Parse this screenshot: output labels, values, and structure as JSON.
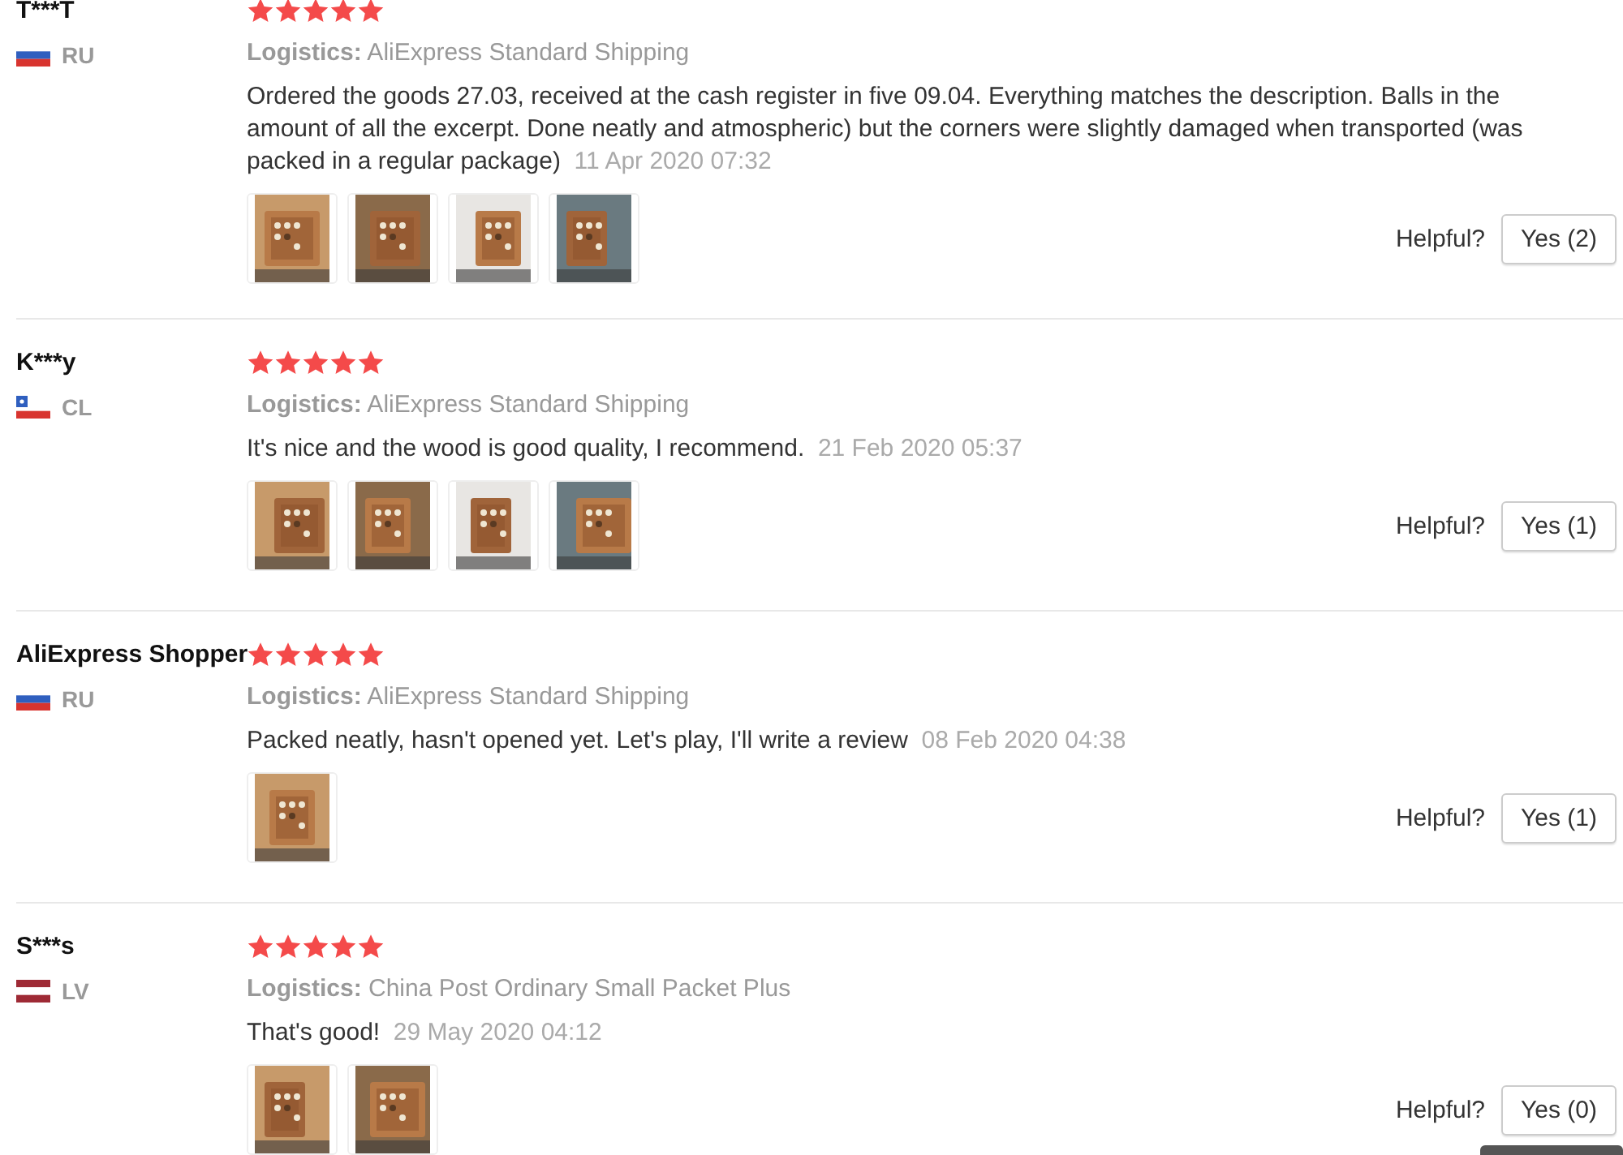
{
  "reviews": [
    {
      "name": "T***T",
      "country": "RU",
      "stars": 5,
      "logistics_label": "Logistics:",
      "logistics": "AliExpress Standard Shipping",
      "text": "Ordered the goods 27.03, received at the cash register in five 09.04. Everything matches the description. Balls in the amount of all the excerpt. Done neatly and atmospheric) but the corners were slightly damaged when transported (was packed in a regular package)",
      "date": "11 Apr 2020 07:32",
      "photos": [
        {
          "kind": "picture"
        },
        {
          "kind": "picture"
        },
        {
          "kind": "picture"
        },
        {
          "kind": "picture"
        }
      ],
      "helpful_label": "Helpful?",
      "helpful_button": "Yes (2)"
    },
    {
      "name": "K***y",
      "country": "CL",
      "stars": 5,
      "logistics_label": "Logistics:",
      "logistics": "AliExpress Standard Shipping",
      "text": "It's nice and the wood is good quality, I recommend.",
      "date": "21 Feb 2020 05:37",
      "photos": [
        {
          "kind": "picture"
        },
        {
          "kind": "picture"
        },
        {
          "kind": "picture"
        },
        {
          "kind": "picture"
        }
      ],
      "helpful_label": "Helpful?",
      "helpful_button": "Yes (1)"
    },
    {
      "name": "AliExpress Shopper",
      "country": "RU",
      "stars": 5,
      "logistics_label": "Logistics:",
      "logistics": "AliExpress Standard Shipping",
      "text": "Packed neatly, hasn't opened yet. Let's play, I'll write a review",
      "date": "08 Feb 2020 04:38",
      "photos": [
        {
          "kind": "picture"
        }
      ],
      "helpful_label": "Helpful?",
      "helpful_button": "Yes (1)"
    },
    {
      "name": "S***s",
      "country": "LV",
      "stars": 5,
      "logistics_label": "Logistics:",
      "logistics": "China Post Ordinary Small Packet Plus",
      "text": "That's good!",
      "date": "29 May 2020 04:12",
      "photos": [
        {
          "kind": "picture"
        },
        {
          "kind": "picture"
        }
      ],
      "helpful_label": "Helpful?",
      "helpful_button": "Yes (0)"
    }
  ]
}
